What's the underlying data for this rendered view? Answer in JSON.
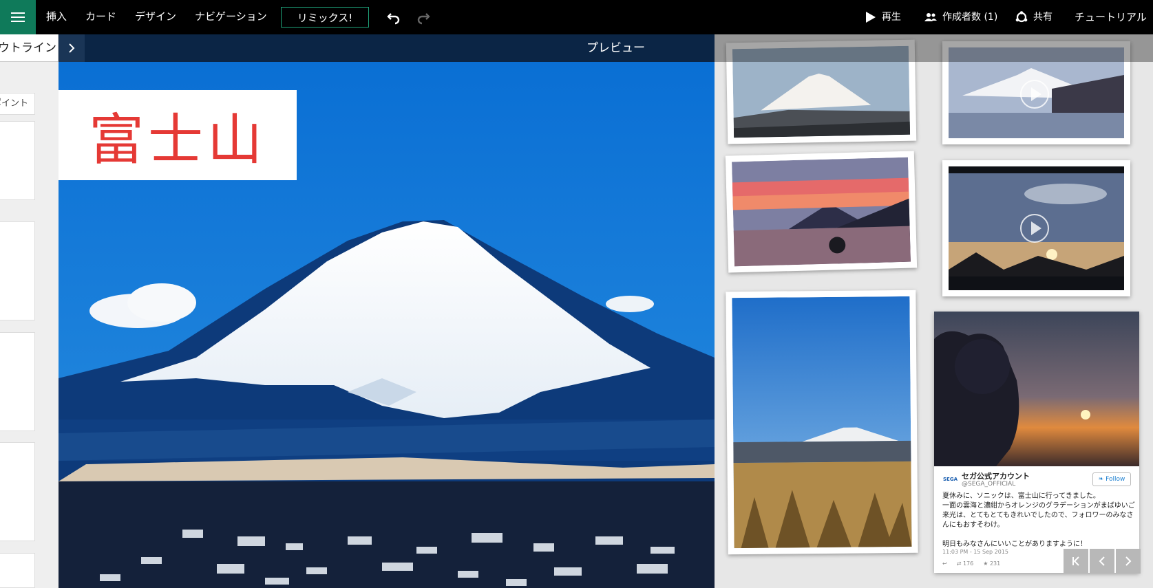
{
  "toolbar": {
    "menu_items": [
      "挿入",
      "カード",
      "デザイン",
      "ナビゲーション"
    ],
    "remix_label": "リミックス!",
    "play_label": "再生",
    "authors_label": "作成者数 (1)",
    "share_label": "共有",
    "tutorial_label": "チュートリアル"
  },
  "outline": {
    "tab_label": "アウトライン",
    "label_text": "ポイント"
  },
  "preview": {
    "label": "プレビュー"
  },
  "hero": {
    "title": "富士山"
  },
  "tweet": {
    "account_name": "セガ公式アカウント",
    "handle": "@SEGA_OFFICIAL",
    "follow_label": "Follow",
    "logo_text": "SEGA",
    "text_lines": [
      "夏休みに、ソニックは、富士山に行ってきました。",
      "一面の雲海と濃紺からオレンジのグラデーションがまばゆいご",
      "来光は、とてもとてもきれいでしたので、フォロワーのみなさ",
      "んにもおすそわけ。",
      "",
      "明日もみなさんにいいことがありますように！"
    ],
    "timestamp": "11:03 PM - 15 Sep 2015",
    "retweets": "176",
    "favorites": "231"
  },
  "colors": {
    "accent": "#0f7a5a",
    "title_red": "#e53935",
    "preview_bar": "#0b2545"
  }
}
